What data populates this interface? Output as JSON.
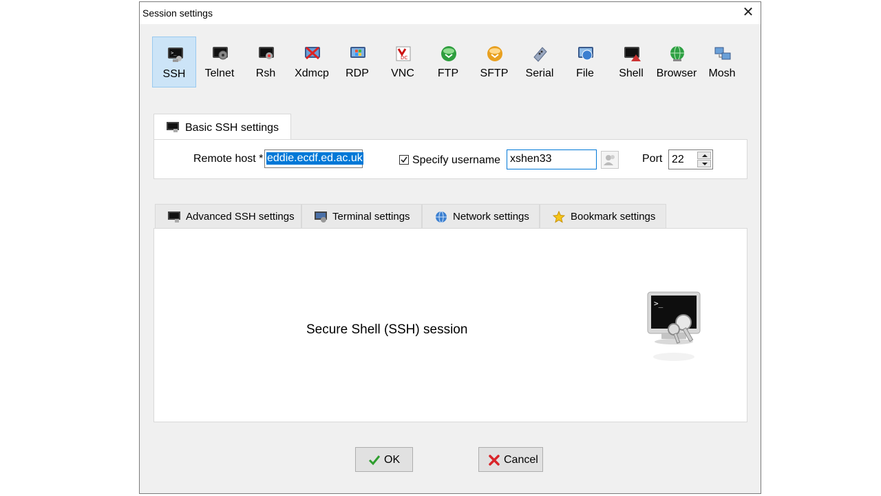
{
  "window": {
    "title": "Session settings",
    "close_glyph": "✕"
  },
  "session_types": [
    {
      "label": "SSH",
      "icon": "ssh-icon",
      "selected": true
    },
    {
      "label": "Telnet",
      "icon": "telnet-icon"
    },
    {
      "label": "Rsh",
      "icon": "rsh-icon"
    },
    {
      "label": "Xdmcp",
      "icon": "xdmcp-icon"
    },
    {
      "label": "RDP",
      "icon": "rdp-icon"
    },
    {
      "label": "VNC",
      "icon": "vnc-icon"
    },
    {
      "label": "FTP",
      "icon": "ftp-icon"
    },
    {
      "label": "SFTP",
      "icon": "sftp-icon"
    },
    {
      "label": "Serial",
      "icon": "serial-icon"
    },
    {
      "label": "File",
      "icon": "file-icon"
    },
    {
      "label": "Shell",
      "icon": "shell-icon"
    },
    {
      "label": "Browser",
      "icon": "browser-icon"
    },
    {
      "label": "Mosh",
      "icon": "mosh-icon"
    }
  ],
  "basic": {
    "tab_label": "Basic SSH settings",
    "remote_host_label": "Remote host *",
    "remote_host_value": "eddie.ecdf.ed.ac.uk",
    "specify_username_label": "Specify username",
    "specify_username_checked": true,
    "username_value": "xshen33",
    "port_label": "Port",
    "port_value": "22"
  },
  "advanced_tabs": [
    {
      "label": "Advanced SSH settings",
      "icon": "terminal-icon"
    },
    {
      "label": "Terminal settings",
      "icon": "terminal-settings-icon"
    },
    {
      "label": "Network settings",
      "icon": "globe-icon"
    },
    {
      "label": "Bookmark settings",
      "icon": "star-icon"
    }
  ],
  "panel": {
    "description": "Secure Shell (SSH) session",
    "prompt_glyph": ">_"
  },
  "buttons": {
    "ok": "OK",
    "cancel": "Cancel"
  },
  "colors": {
    "selection_bg": "#cce4f7",
    "text_highlight": "#0078d7",
    "ok_check": "#2e9e2e",
    "cancel_x": "#d9252a"
  }
}
